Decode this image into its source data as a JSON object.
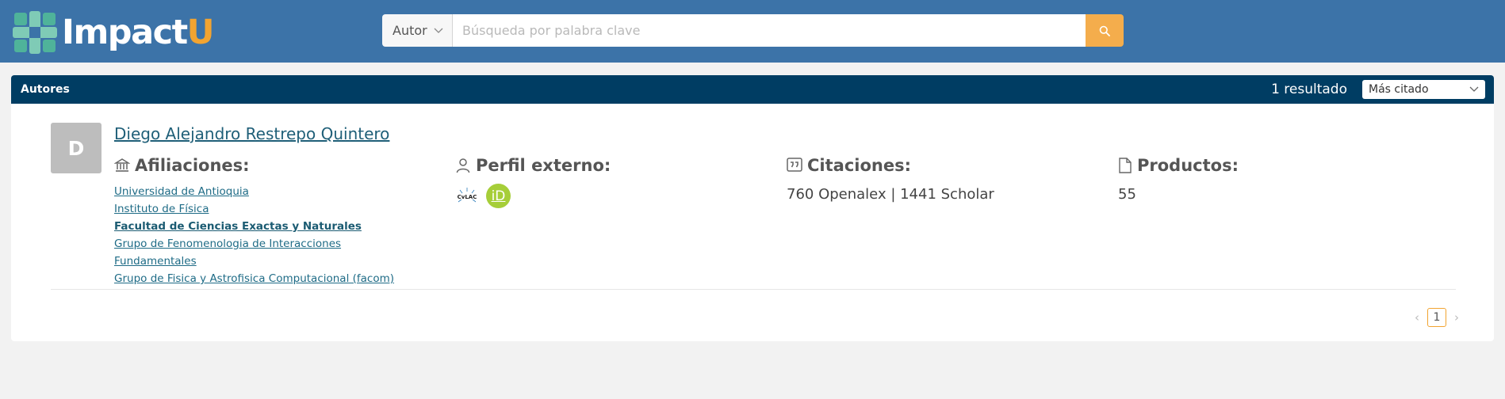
{
  "header": {
    "logo": {
      "text_main": "Impact",
      "text_accent": "U"
    },
    "search": {
      "type_label": "Autor",
      "placeholder": "Búsqueda por palabra clave",
      "value": ""
    }
  },
  "results": {
    "title": "Autores",
    "count_label": "1 resultado",
    "sort_label": "Más citado",
    "authors": [
      {
        "initial": "D",
        "name": "Diego Alejandro Restrepo Quintero",
        "affiliations_heading": "Afiliaciones:",
        "affiliations": [
          "Universidad de Antioquia",
          "Instituto de Física",
          "Facultad de Ciencias Exactas y Naturales",
          "Grupo de Fenomenologia de Interacciones",
          "Fundamentales",
          "Grupo de Fisica y Astrofisica Computacional (facom)"
        ],
        "profile_heading": "Perfil externo:",
        "profiles": [
          {
            "label": "CvLAC",
            "icon": "cvlac-icon"
          },
          {
            "label": "iD",
            "icon": "orcid-icon"
          }
        ],
        "citations_heading": "Citaciones:",
        "citations_value": "760 Openalex | 1441 Scholar",
        "products_heading": "Productos:",
        "products_value": "55"
      }
    ]
  },
  "pagination": {
    "current_page": "1",
    "prev": "‹",
    "next": "›"
  },
  "colors": {
    "header_bg": "#3c73a8",
    "accent": "#f2a431",
    "card_header_bg": "#003d63",
    "link": "#1e6b86",
    "orcid": "#a6ce39"
  }
}
